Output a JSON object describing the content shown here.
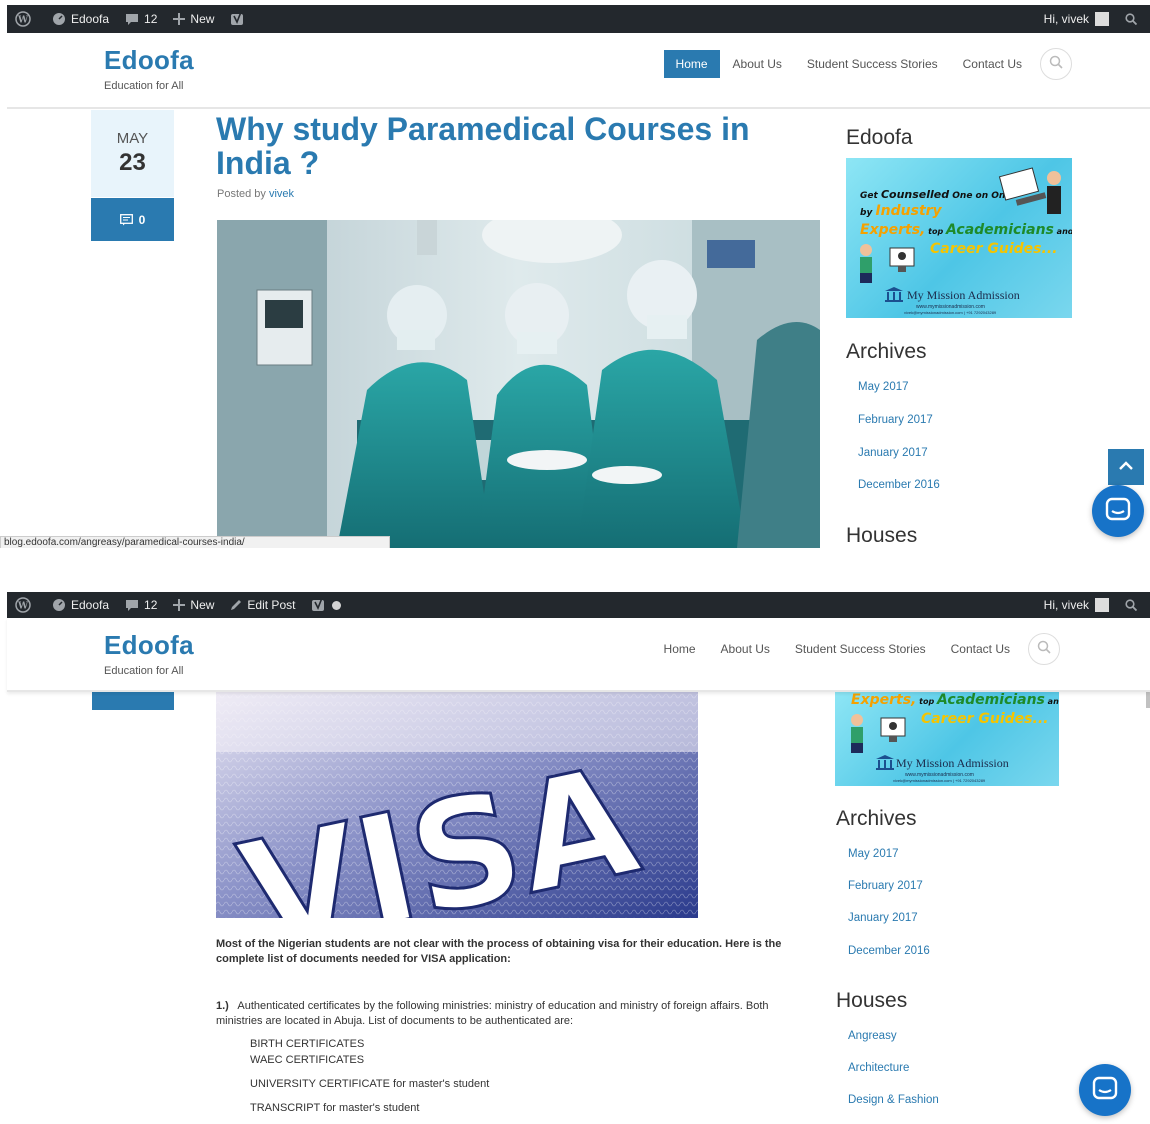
{
  "adminbar1": {
    "site": "Edoofa",
    "comments": "12",
    "new": "New",
    "greeting": "Hi, vivek"
  },
  "adminbar2": {
    "site": "Edoofa",
    "comments": "12",
    "new": "New",
    "edit_post": "Edit Post",
    "greeting": "Hi, vivek"
  },
  "site": {
    "name": "Edoofa",
    "tagline": "Education for All"
  },
  "nav": {
    "items": [
      "Home",
      "About Us",
      "Student Success Stories",
      "Contact Us"
    ],
    "active": "Home"
  },
  "post": {
    "month": "MAY",
    "day": "23",
    "comments": "0",
    "title": "Why study Paramedical Courses in India ?",
    "posted_by": "Posted by",
    "author": "vivek"
  },
  "sidebar": {
    "edoofa_title": "Edoofa",
    "ad": {
      "line1a": "Get ",
      "line1b": "Counselled",
      "line1c": " One on One",
      "line2a": "by ",
      "line2b": "Industry",
      "line3a": "Experts,",
      "line3b": " top ",
      "line3c": "Academicians",
      "line3d": " and",
      "line4": "Career Guides...",
      "brand": "My Mission Admission",
      "url": "www.mymissionadmission.com",
      "contact": "vivek@mymissionadmission.com | +91 7292043289"
    },
    "archives_title": "Archives",
    "archives": [
      "May 2017",
      "February 2017",
      "January 2017",
      "December 2016"
    ],
    "houses_title": "Houses",
    "houses": [
      "Angreasy",
      "Architecture",
      "Design & Fashion"
    ]
  },
  "status_url": "blog.edoofa.com/angreasy/paramedical-courses-india/",
  "visa_image_text": "VISA",
  "article": {
    "intro": "Most of the Nigerian students are not clear with the process of obtaining visa for their education. Here is the complete list of documents needed for VISA application:",
    "point1_num": "1.)",
    "point1_text": "Authenticated certificates by the following ministries: ministry of education and ministry of foreign affairs. Both ministries are located in Abuja.  List of documents to be authenticated are:",
    "docs": [
      "BIRTH CERTIFICATES",
      "WAEC CERTIFICATES",
      "UNIVERSITY CERTIFICATE for master's student",
      "TRANSCRIPT for master's student"
    ]
  },
  "colors": {
    "brand_blue": "#2a7ab0",
    "admin_bar": "#23282d",
    "chat_blue": "#1773c8"
  }
}
